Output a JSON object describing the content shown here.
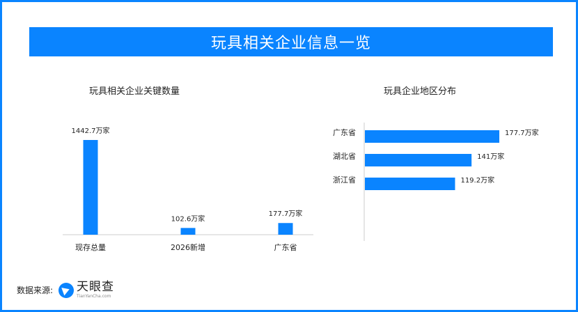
{
  "title": "玩具相关企业信息一览",
  "source_label": "数据来源:",
  "logo": {
    "name": "天眼查",
    "url_text": "TianYanCha.com"
  },
  "colors": {
    "accent": "#0a84ff",
    "bar": "#0a84ff",
    "axis": "#cccccc"
  },
  "chart_data": [
    {
      "type": "bar",
      "title": "玩具相关企业关键数量",
      "categories": [
        "现存总量",
        "2026新增",
        "广东省"
      ],
      "values": [
        1442.7,
        102.6,
        177.7
      ],
      "value_labels": [
        "1442.7万家",
        "102.6万家",
        "177.7万家"
      ],
      "unit": "万家",
      "ylim": [
        0,
        1442.7
      ],
      "xlabel": "",
      "ylabel": ""
    },
    {
      "type": "bar",
      "orientation": "horizontal",
      "title": "玩具企业地区分布",
      "categories": [
        "广东省",
        "湖北省",
        "浙江省"
      ],
      "values": [
        177.7,
        141,
        119.2
      ],
      "value_labels": [
        "177.7万家",
        "141万家",
        "119.2万家"
      ],
      "unit": "万家",
      "xlim": [
        0,
        177.7
      ],
      "xlabel": "",
      "ylabel": ""
    }
  ]
}
